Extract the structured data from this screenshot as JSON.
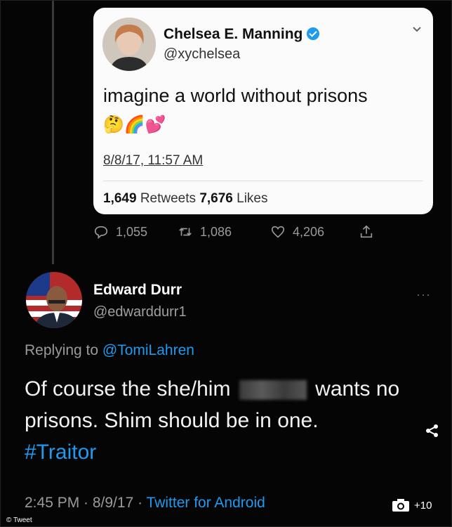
{
  "quoted_tweet": {
    "name": "Chelsea E. Manning",
    "handle": "@xychelsea",
    "text": "imagine a world without prisons",
    "emojis": "🤔🌈💕",
    "timestamp": "8/8/17, 11:57 AM",
    "retweets_count": "1,649",
    "retweets_label": "Retweets",
    "likes_count": "7,676",
    "likes_label": "Likes"
  },
  "actions": {
    "replies": "1,055",
    "retweets": "1,086",
    "likes": "4,206"
  },
  "reply_tweet": {
    "name": "Edward Durr",
    "handle": "@edwarddurr1",
    "replying_prefix": "Replying to",
    "replying_to": "@TomiLahren",
    "body_part1": "Of course the she/him",
    "body_part2": "wants no prisons. Shim should be in one.",
    "hashtag": "#Traitor",
    "time": "2:45 PM · 8/9/17 · ",
    "source": "Twitter for Android",
    "more": "···"
  },
  "caption": "© Tweet",
  "gallery_count": "+10",
  "colors": {
    "link": "#1d9bf0",
    "background": "#000000",
    "card": "#fbfbfb"
  }
}
